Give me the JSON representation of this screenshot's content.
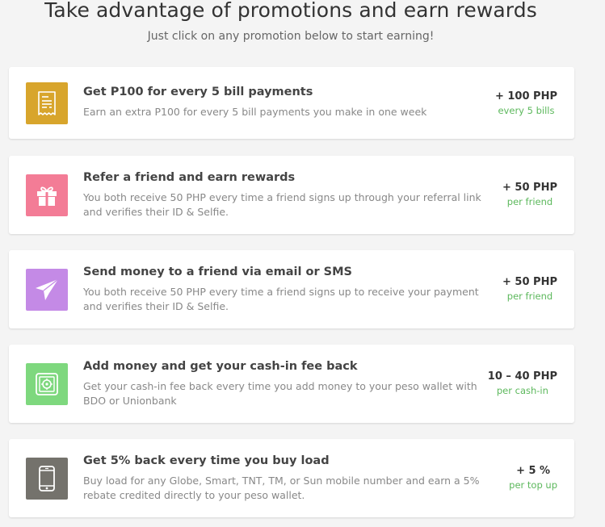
{
  "header": {
    "title": "Take advantage of promotions and earn rewards",
    "subtitle": "Just click on any promotion below to start earning!"
  },
  "colors": {
    "bill_icon_bg": "#d8a52c",
    "gift_icon_bg": "#f37c96",
    "send_icon_bg": "#c48ae6",
    "cashin_icon_bg": "#7ed87e",
    "load_icon_bg": "#74726c",
    "reward_unit": "#5cb85c"
  },
  "promotions": [
    {
      "icon": "receipt-icon",
      "title": "Get P100 for every 5 bill payments",
      "description": "Earn an extra P100 for every 5 bill payments you make in one week",
      "reward_amount": "+ 100 PHP",
      "reward_unit": "every 5 bills"
    },
    {
      "icon": "gift-icon",
      "title": "Refer a friend and earn rewards",
      "description": "You both receive 50 PHP every time a friend signs up through your referral link and verifies their ID & Selfie.",
      "reward_amount": "+ 50 PHP",
      "reward_unit": "per friend"
    },
    {
      "icon": "paper-plane-icon",
      "title": "Send money to a friend via email or SMS",
      "description": "You both receive 50 PHP every time a friend signs up to receive your payment and verifies their ID & Selfie.",
      "reward_amount": "+ 50 PHP",
      "reward_unit": "per friend"
    },
    {
      "icon": "safe-icon",
      "title": "Add money and get your cash-in fee back",
      "description": "Get your cash-in fee back every time you add money to your peso wallet with BDO or Unionbank",
      "reward_amount": "10 – 40 PHP",
      "reward_unit": "per cash-in"
    },
    {
      "icon": "mobile-phone-icon",
      "title": "Get 5% back every time you buy load",
      "description": "Buy load for any Globe, Smart, TNT, TM, or Sun mobile number and earn a 5% rebate credited directly to your peso wallet.",
      "reward_amount": "+ 5 %",
      "reward_unit": "per top up"
    }
  ]
}
